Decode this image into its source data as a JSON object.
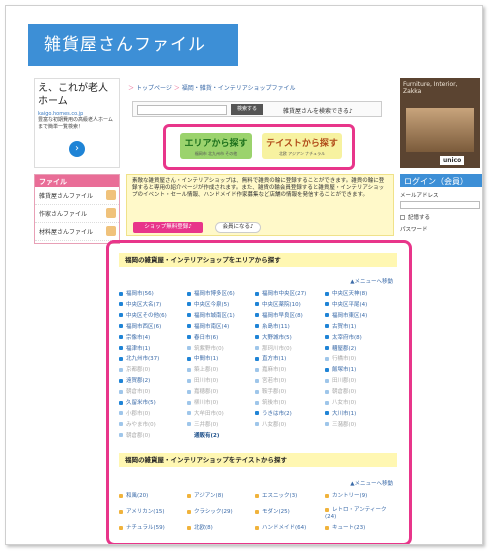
{
  "site": {
    "banner_title": "雑貨屋さんファイル"
  },
  "ad_left": {
    "title": "え、これが老人ホーム",
    "url": "kaigo.homes.co.jp",
    "text": "豊富な初期費用の高級老人ホーム まで簡単一覧検索！",
    "arrow": "›"
  },
  "file_menu": {
    "header": "ファイル",
    "items": [
      "雑貨屋さんファイル",
      "作家さんファイル",
      "材料屋さんファイル"
    ]
  },
  "breadcrumb": {
    "items": [
      "トップページ",
      "福岡・雑貨・インテリアショップファイル"
    ],
    "sep": "＞"
  },
  "search": {
    "placeholder": "",
    "button": "検索する",
    "message": "雑貨屋さんを検索できる♪"
  },
  "pick": {
    "area": {
      "label": "エリアから探す",
      "sub": "福岡市 北九州市 その他"
    },
    "taste": {
      "label": "テイストから探す",
      "sub": "北欧 アジアン ナチュラル"
    }
  },
  "info": {
    "text": "素敵な雑貨屋さん・インテリアショップは、無料で雑貨の輪に登録することができます。雑貨の輪に登録すると専用の紹介ページが作成されます。また、雑貨の輪会員登録すると雑貨屋・インテリアショップのイベント・セール情報、ハンドメイド作家募集など店舗の情報を発信することができます。",
    "register_button": "ショップ無料登録♪",
    "member_button": "会員になる♪"
  },
  "ad_right": {
    "text": "Furniture, Interior, Zakka",
    "brand": "unico",
    "tag": "Ad"
  },
  "login": {
    "header": "ログイン（会員）",
    "email_label": "メールアドレス",
    "remember_label": "記憶する",
    "password_label": "パスワード"
  },
  "area_section": {
    "title": "福岡の雑貨屋・インテリアショップをエリアから探す",
    "menu_link": "▲メニューへ移動",
    "items": [
      {
        "label": "福岡市(56)",
        "state": "on"
      },
      {
        "label": "福岡市博多区(6)",
        "state": "on"
      },
      {
        "label": "福岡市中央区(27)",
        "state": "on"
      },
      {
        "label": "中央区天神(8)",
        "state": "on"
      },
      {
        "label": "中央区大名(7)",
        "state": "on"
      },
      {
        "label": "中央区今泉(5)",
        "state": "on"
      },
      {
        "label": "中央区薬院(10)",
        "state": "on"
      },
      {
        "label": "中央区平尾(4)",
        "state": "on"
      },
      {
        "label": "中央区その他(6)",
        "state": "on"
      },
      {
        "label": "福岡市城南区(1)",
        "state": "on"
      },
      {
        "label": "福岡市早良区(8)",
        "state": "on"
      },
      {
        "label": "福岡市東区(4)",
        "state": "on"
      },
      {
        "label": "福岡市西区(6)",
        "state": "on"
      },
      {
        "label": "福岡市南区(4)",
        "state": "on"
      },
      {
        "label": "糸島市(11)",
        "state": "on"
      },
      {
        "label": "古賀市(1)",
        "state": "on"
      },
      {
        "label": "宗像市(4)",
        "state": "on"
      },
      {
        "label": "春日市(6)",
        "state": "on"
      },
      {
        "label": "大野城市(5)",
        "state": "on"
      },
      {
        "label": "太宰府市(8)",
        "state": "on"
      },
      {
        "label": "福津市(1)",
        "state": "on"
      },
      {
        "label": "筑紫野市(0)",
        "state": "zero"
      },
      {
        "label": "那珂川市(0)",
        "state": "zero"
      },
      {
        "label": "糟屋郡(2)",
        "state": "on"
      },
      {
        "label": "北九州市(37)",
        "state": "on"
      },
      {
        "label": "中間市(1)",
        "state": "on"
      },
      {
        "label": "直方市(1)",
        "state": "on"
      },
      {
        "label": "行橋市(0)",
        "state": "zero"
      },
      {
        "label": "京都郡(0)",
        "state": "zero"
      },
      {
        "label": "築上郡(0)",
        "state": "zero"
      },
      {
        "label": "嘉麻市(0)",
        "state": "zero"
      },
      {
        "label": "飯塚市(1)",
        "state": "on"
      },
      {
        "label": "遠賀郡(2)",
        "state": "on"
      },
      {
        "label": "田川市(0)",
        "state": "zero"
      },
      {
        "label": "宮若市(0)",
        "state": "zero"
      },
      {
        "label": "田川郡(0)",
        "state": "zero"
      },
      {
        "label": "朝倉市(0)",
        "state": "zero"
      },
      {
        "label": "嘉穂郡(0)",
        "state": "zero"
      },
      {
        "label": "鞍手郡(0)",
        "state": "zero"
      },
      {
        "label": "朝倉郡(0)",
        "state": "zero"
      },
      {
        "label": "久留米市(5)",
        "state": "on"
      },
      {
        "label": "柳川市(0)",
        "state": "zero"
      },
      {
        "label": "筑後市(0)",
        "state": "zero"
      },
      {
        "label": "八女市(0)",
        "state": "zero"
      },
      {
        "label": "小郡市(0)",
        "state": "zero"
      },
      {
        "label": "大牟田市(0)",
        "state": "zero"
      },
      {
        "label": "うきは市(2)",
        "state": "on"
      },
      {
        "label": "大川市(1)",
        "state": "on"
      },
      {
        "label": "みやま市(0)",
        "state": "zero"
      },
      {
        "label": "三井郡(0)",
        "state": "zero"
      },
      {
        "label": "八女郡(0)",
        "state": "zero"
      },
      {
        "label": "三潴郡(0)",
        "state": "zero"
      },
      {
        "label": "朝倉郡(0)",
        "state": "zero"
      },
      {
        "label": "通販有(2)",
        "state": "bold"
      }
    ]
  },
  "taste_section": {
    "title": "福岡の雑貨屋・インテリアショップをテイストから探す",
    "menu_link": "▲メニューへ移動",
    "items": [
      {
        "label": "和風(20)"
      },
      {
        "label": "アジアン(8)"
      },
      {
        "label": "エスニック(3)"
      },
      {
        "label": "カントリー(9)"
      },
      {
        "label": "アメリカン(15)"
      },
      {
        "label": "クラシック(29)"
      },
      {
        "label": "モダン(25)"
      },
      {
        "label": "レトロ・アンティーク(24)"
      },
      {
        "label": "ナチュラル(59)"
      },
      {
        "label": "北欧(8)"
      },
      {
        "label": "ハンドメイド(64)"
      },
      {
        "label": "キュート(23)"
      }
    ]
  }
}
